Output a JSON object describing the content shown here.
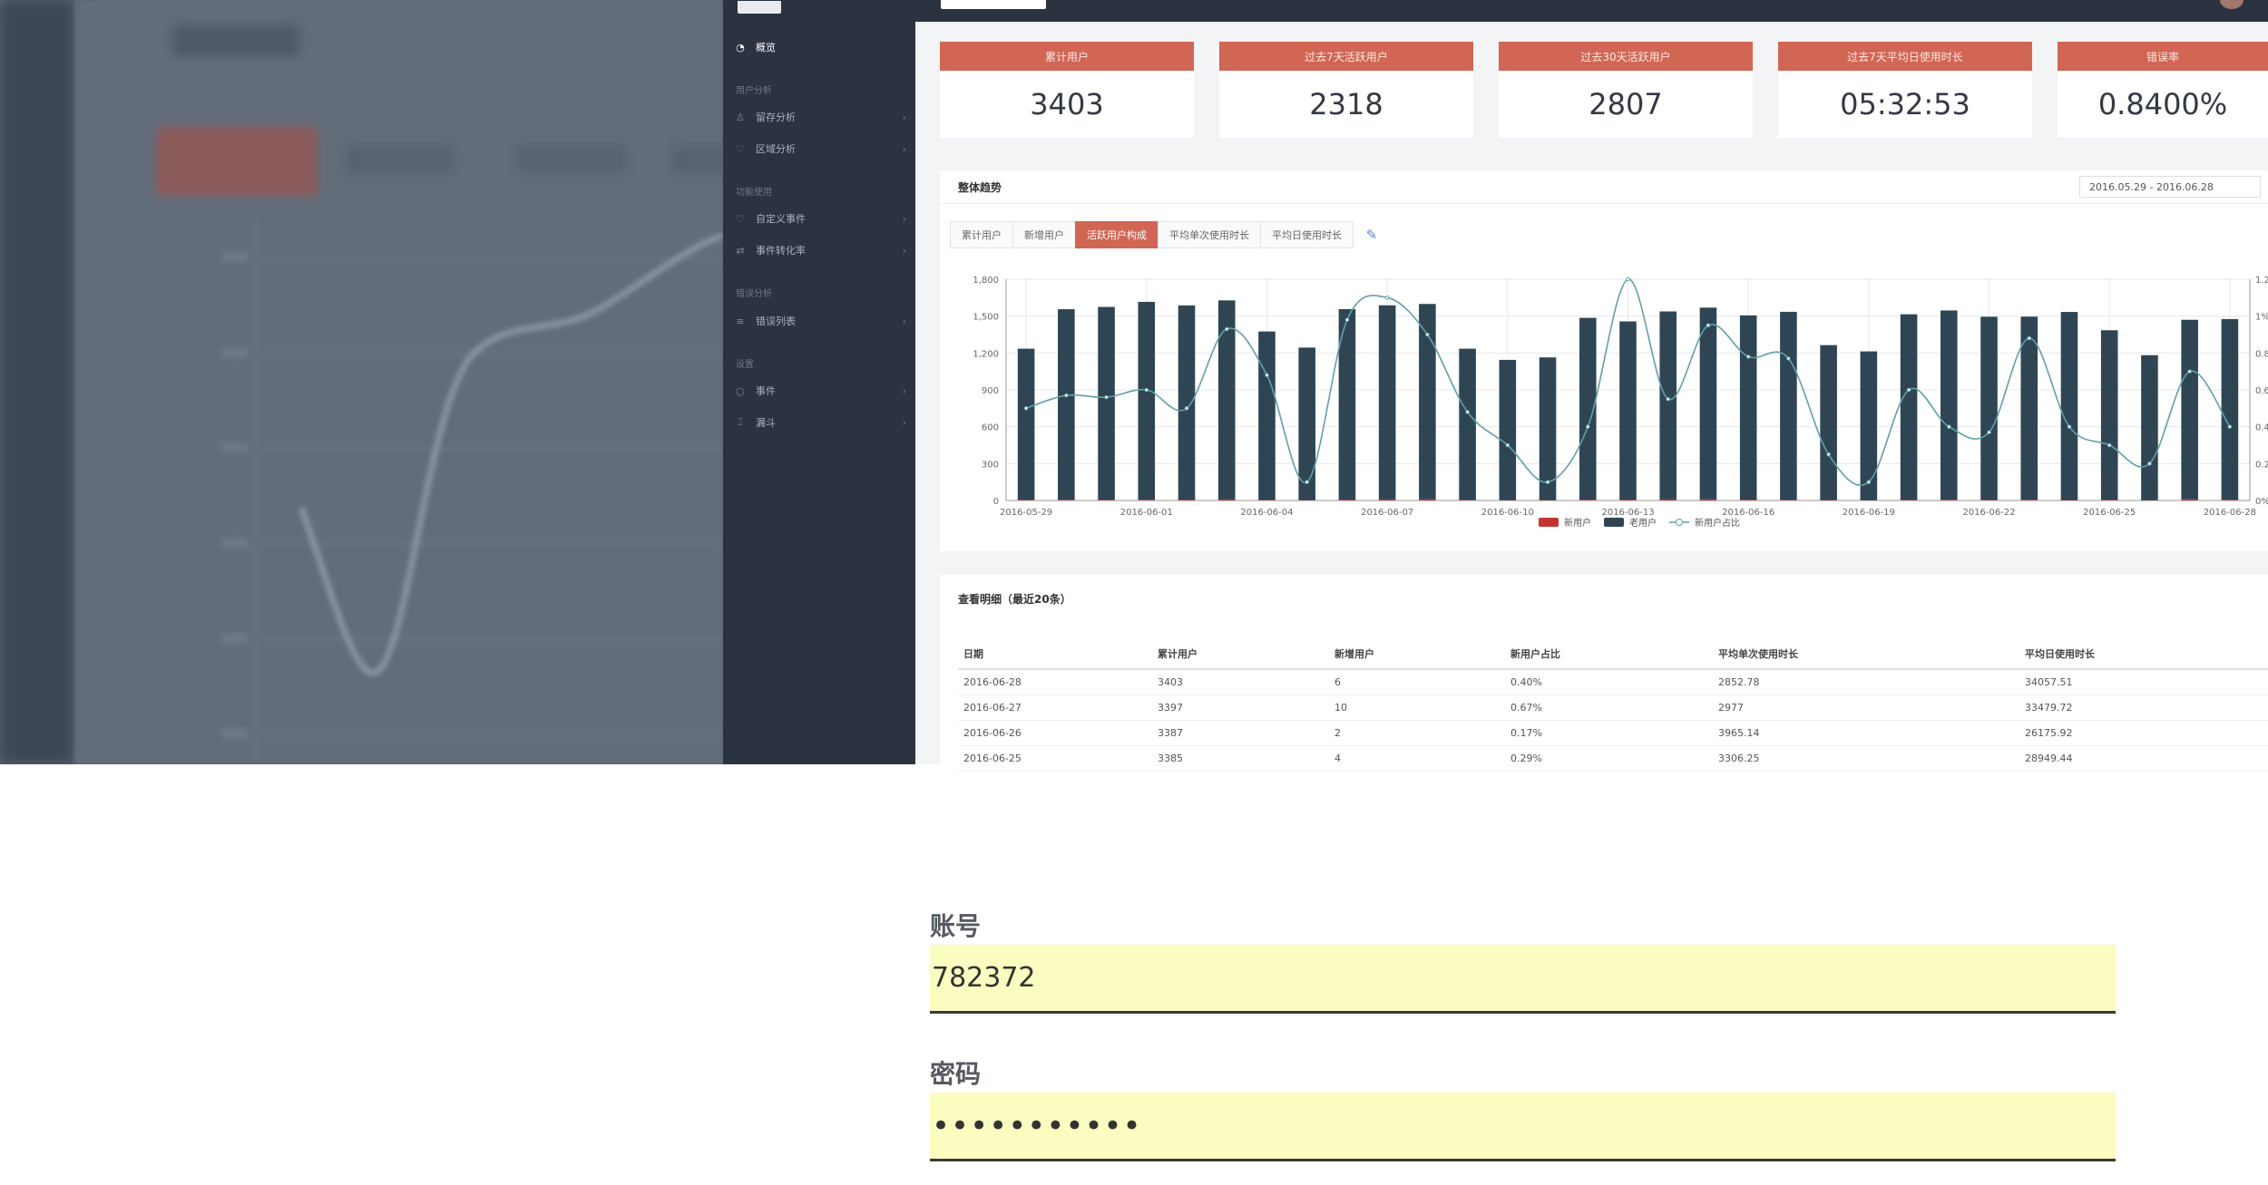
{
  "sidebar": {
    "items": [
      {
        "label": "概览",
        "icon": "dashboard-icon",
        "active": true
      },
      {
        "section": "用户分析"
      },
      {
        "label": "留存分析",
        "icon": "user-icon"
      },
      {
        "label": "区域分析",
        "icon": "location-icon"
      },
      {
        "section": "功能使用"
      },
      {
        "label": "自定义事件",
        "icon": "heart-icon"
      },
      {
        "label": "事件转化率",
        "icon": "shuffle-icon"
      },
      {
        "section": "错误分析"
      },
      {
        "label": "错误列表",
        "icon": "list-icon"
      },
      {
        "section": "设置"
      },
      {
        "label": "事件",
        "icon": "circle-icon"
      },
      {
        "label": "漏斗",
        "icon": "funnel-icon"
      }
    ]
  },
  "cards": [
    {
      "label": "累计用户",
      "value": "3403"
    },
    {
      "label": "过去7天活跃用户",
      "value": "2318"
    },
    {
      "label": "过去30天活跃用户",
      "value": "2807"
    },
    {
      "label": "过去7天平均日使用时长",
      "value": "05:32:53"
    },
    {
      "label": "错误率",
      "value": "0.8400%"
    }
  ],
  "trend": {
    "title": "整体趋势",
    "date_range": "2016.05.29 - 2016.06.28",
    "tabs": [
      "累计用户",
      "新增用户",
      "活跃用户构成",
      "平均单次使用时长",
      "平均日使用时长"
    ],
    "active_tab": 2
  },
  "chart_data": {
    "type": "bar",
    "x": [
      "2016-05-29",
      "2016-05-30",
      "2016-05-31",
      "2016-06-01",
      "2016-06-02",
      "2016-06-03",
      "2016-06-04",
      "2016-06-05",
      "2016-06-06",
      "2016-06-07",
      "2016-06-08",
      "2016-06-09",
      "2016-06-10",
      "2016-06-11",
      "2016-06-12",
      "2016-06-13",
      "2016-06-14",
      "2016-06-15",
      "2016-06-16",
      "2016-06-17",
      "2016-06-18",
      "2016-06-19",
      "2016-06-20",
      "2016-06-21",
      "2016-06-22",
      "2016-06-23",
      "2016-06-24",
      "2016-06-25",
      "2016-06-26",
      "2016-06-27",
      "2016-06-28"
    ],
    "tick_labels": [
      "2016-05-29",
      "2016-06-01",
      "2016-06-04",
      "2016-06-07",
      "2016-06-10",
      "2016-06-13",
      "2016-06-16",
      "2016-06-19",
      "2016-06-22",
      "2016-06-25",
      "2016-06-28"
    ],
    "series": [
      {
        "name": "新用户",
        "color": "#c23531",
        "values": [
          5,
          6,
          5,
          6,
          7,
          8,
          5,
          4,
          7,
          8,
          9,
          5,
          4,
          4,
          6,
          7,
          8,
          9,
          6,
          5,
          4,
          3,
          5,
          6,
          5,
          6,
          4,
          5,
          2,
          10,
          6
        ]
      },
      {
        "name": "老用户",
        "color": "#2f4554",
        "values": [
          1230,
          1550,
          1570,
          1610,
          1580,
          1620,
          1370,
          1240,
          1550,
          1580,
          1590,
          1230,
          1140,
          1160,
          1480,
          1450,
          1530,
          1560,
          1500,
          1530,
          1260,
          1210,
          1510,
          1540,
          1490,
          1490,
          1530,
          1380,
          1180,
          1460,
          1470
        ]
      },
      {
        "name": "新用户占比",
        "color": "#61a0a8",
        "axis": "right",
        "values": [
          0.5,
          0.57,
          0.56,
          0.6,
          0.5,
          0.93,
          0.68,
          0.1,
          0.98,
          1.1,
          0.9,
          0.48,
          0.3,
          0.1,
          0.4,
          1.2,
          0.55,
          0.95,
          0.78,
          0.77,
          0.25,
          0.1,
          0.6,
          0.4,
          0.37,
          0.88,
          0.4,
          0.3,
          0.2,
          0.7,
          0.4
        ]
      }
    ],
    "ylim": [
      0,
      1400
    ],
    "y_ticks": [
      "0",
      "300",
      "600",
      "900",
      "1,200",
      "1,500",
      "1,800"
    ],
    "y2_ticks": [
      "0%",
      "0.2%",
      "0.4%",
      "0.6%",
      "0.8%",
      "1%",
      "1.2%"
    ],
    "y2lim": [
      0,
      1.2
    ],
    "grid": true,
    "legend": "bottom-center"
  },
  "detail": {
    "title": "查看明细（最近20条）",
    "columns": [
      "日期",
      "累计用户",
      "新增用户",
      "新用户占比",
      "平均单次使用时长",
      "平均日使用时长"
    ],
    "rows": [
      [
        "2016-06-28",
        "3403",
        "6",
        "0.40%",
        "2852.78",
        "34057.51"
      ],
      [
        "2016-06-27",
        "3397",
        "10",
        "0.67%",
        "2977",
        "33479.72"
      ],
      [
        "2016-06-26",
        "3387",
        "2",
        "0.17%",
        "3965.14",
        "26175.92"
      ],
      [
        "2016-06-25",
        "3385",
        "4",
        "0.29%",
        "3306.25",
        "28949.44"
      ]
    ]
  },
  "login": {
    "account_label": "账号",
    "account_value": "782372",
    "password_label": "密码",
    "password_value": "•••••••••••"
  }
}
